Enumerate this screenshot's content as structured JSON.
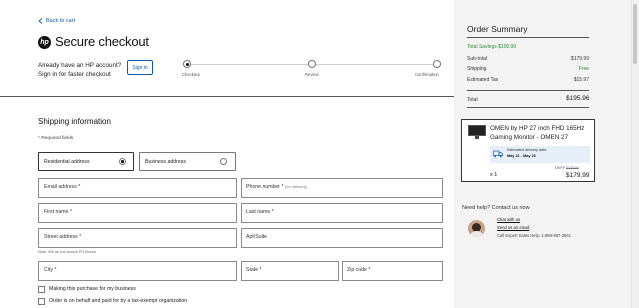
{
  "nav": {
    "back_label": "Back to cart"
  },
  "brand": {
    "logo_text": "hp"
  },
  "header": {
    "title": "Secure checkout"
  },
  "signin": {
    "question_line1": "Already have an HP account?",
    "question_line2": "Sign in for faster checkout",
    "button_label": "Sign in"
  },
  "steps": [
    {
      "label": "Checkout",
      "active": true
    },
    {
      "label": "Review",
      "active": false
    },
    {
      "label": "Confirmation",
      "active": false
    }
  ],
  "shipping": {
    "title": "Shipping information",
    "required_note": "* Required fields",
    "address_types": [
      {
        "label": "Residential address",
        "selected": true
      },
      {
        "label": "Business address",
        "selected": false
      }
    ],
    "fields": {
      "email": "Email address *",
      "phone": "Phone number *",
      "phone_hint": "(for delivery)",
      "first_name": "First name *",
      "last_name": "Last name *",
      "street": "Street address *",
      "street_hint": "Note: We do not accept PO Boxes",
      "apt": "Apt/Suite",
      "city": "City *",
      "state": "State *",
      "zip": "Zip code *"
    },
    "checkboxes": [
      {
        "label": "Making this purchase for my business",
        "checked": false
      },
      {
        "label": "Order is on behalf and paid for by a tax-exempt organization",
        "checked": false
      }
    ]
  },
  "summary": {
    "title": "Order Summary",
    "total_savings": "Total Savings $100.00",
    "rows": [
      {
        "label": "Sub-total",
        "value": "$179.99"
      },
      {
        "label": "Shipping",
        "value": "Free"
      },
      {
        "label": "Estimated Tax",
        "value": "$15.97"
      }
    ],
    "total_label": "Total",
    "total_value": "$195.96"
  },
  "product": {
    "name_line1": "OMEN by HP 27 inch FHD 165Hz",
    "name_line2": "Gaming Monitor - OMEN 27",
    "delivery_label": "Estimated delivery date",
    "delivery_dates": "May 21 - May 26",
    "quantity": "x 1",
    "msrp_label": "MSRP",
    "msrp_value": "$279.99",
    "price": "$179.99"
  },
  "help": {
    "question": "Need help? Contact us now",
    "chat_link": "Chat with us",
    "email_link": "Send us an email",
    "phone_text": "Call Expert Sales Help: 1-888-997-3561"
  },
  "colors": {
    "link": "#0b5cad",
    "savings": "#2e8b3a",
    "panel_bg": "#f3f3f3"
  }
}
